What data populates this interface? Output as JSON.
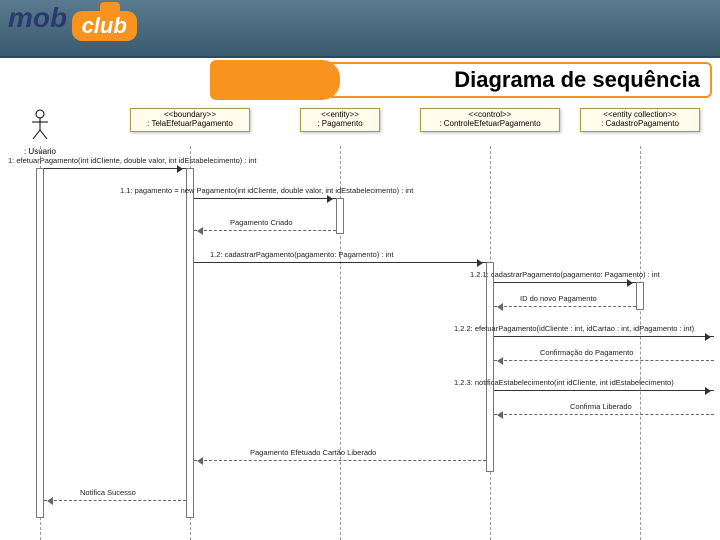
{
  "logo": {
    "part1": "mob",
    "part2": "club"
  },
  "title": "Diagrama de sequência",
  "participants": {
    "actor": {
      "label": ": Usuario"
    },
    "boundary": {
      "stereo": "<<boundary>>",
      "name": ": TelaEfetuarPagamento"
    },
    "entity": {
      "stereo": "<<entity>>",
      "name": ": Pagamento"
    },
    "control": {
      "stereo": "<<control>>",
      "name": ": ControleEfetuarPagamento"
    },
    "collection": {
      "stereo": "<<entity collection>>",
      "name": ": CadastroPagamento"
    }
  },
  "messages": {
    "m1": "1: efetuarPagamento(int idCliente, double valor, int idEstabelecimento) : int",
    "m11": "1.1: pagamento = new Pagamento(int idCliente, double valor, int idEstabelecimento) : int",
    "r11": "Pagamento Criado",
    "m12": "1.2: cadastrarPagamento(pagamento: Pagamento) : int",
    "m121": "1.2.1: cadastrarPagamento(pagamento: Pagamento) : int",
    "r121": "ID do novo Pagamento",
    "m122": "1.2.2: efetuarPagamento(idCliente : int, idCartao : int, idPagamento : int)",
    "r122": "Confirmação do Pagamento",
    "m123": "1.2.3: notificaEstabelecimento(int idCliente, int idEstabelecimento)",
    "r123": "Confirma Liberado",
    "r12": "Pagamento Efetuado Cartão Liberado",
    "r1": "Notifica Sucesso"
  },
  "chart_data": {
    "type": "sequence-diagram",
    "participants": [
      {
        "id": "usuario",
        "kind": "actor",
        "name": ": Usuario"
      },
      {
        "id": "tela",
        "kind": "boundary",
        "name": ": TelaEfetuarPagamento"
      },
      {
        "id": "pagamento",
        "kind": "entity",
        "name": ": Pagamento"
      },
      {
        "id": "controle",
        "kind": "control",
        "name": ": ControleEfetuarPagamento"
      },
      {
        "id": "cadastro",
        "kind": "entity collection",
        "name": ": CadastroPagamento"
      }
    ],
    "messages": [
      {
        "seq": "1",
        "from": "usuario",
        "to": "tela",
        "label": "efetuarPagamento(int idCliente, double valor, int idEstabelecimento) : int",
        "kind": "call"
      },
      {
        "seq": "1.1",
        "from": "tela",
        "to": "pagamento",
        "label": "pagamento = new Pagamento(int idCliente, double valor, int idEstabelecimento) : int",
        "kind": "create"
      },
      {
        "seq": "",
        "from": "pagamento",
        "to": "tela",
        "label": "Pagamento Criado",
        "kind": "return"
      },
      {
        "seq": "1.2",
        "from": "tela",
        "to": "controle",
        "label": "cadastrarPagamento(pagamento: Pagamento) : int",
        "kind": "call"
      },
      {
        "seq": "1.2.1",
        "from": "controle",
        "to": "cadastro",
        "label": "cadastrarPagamento(pagamento: Pagamento) : int",
        "kind": "call"
      },
      {
        "seq": "",
        "from": "cadastro",
        "to": "controle",
        "label": "ID do novo Pagamento",
        "kind": "return"
      },
      {
        "seq": "1.2.2",
        "from": "controle",
        "to": "external-right",
        "label": "efetuarPagamento(idCliente : int, idCartao : int, idPagamento : int)",
        "kind": "call"
      },
      {
        "seq": "",
        "from": "external-right",
        "to": "controle",
        "label": "Confirmação do Pagamento",
        "kind": "return"
      },
      {
        "seq": "1.2.3",
        "from": "controle",
        "to": "external-right",
        "label": "notificaEstabelecimento(int idCliente, int idEstabelecimento)",
        "kind": "call"
      },
      {
        "seq": "",
        "from": "external-right",
        "to": "controle",
        "label": "Confirma Liberado",
        "kind": "return"
      },
      {
        "seq": "",
        "from": "controle",
        "to": "tela",
        "label": "Pagamento Efetuado Cartão Liberado",
        "kind": "return"
      },
      {
        "seq": "",
        "from": "tela",
        "to": "usuario",
        "label": "Notifica Sucesso",
        "kind": "return"
      }
    ]
  }
}
